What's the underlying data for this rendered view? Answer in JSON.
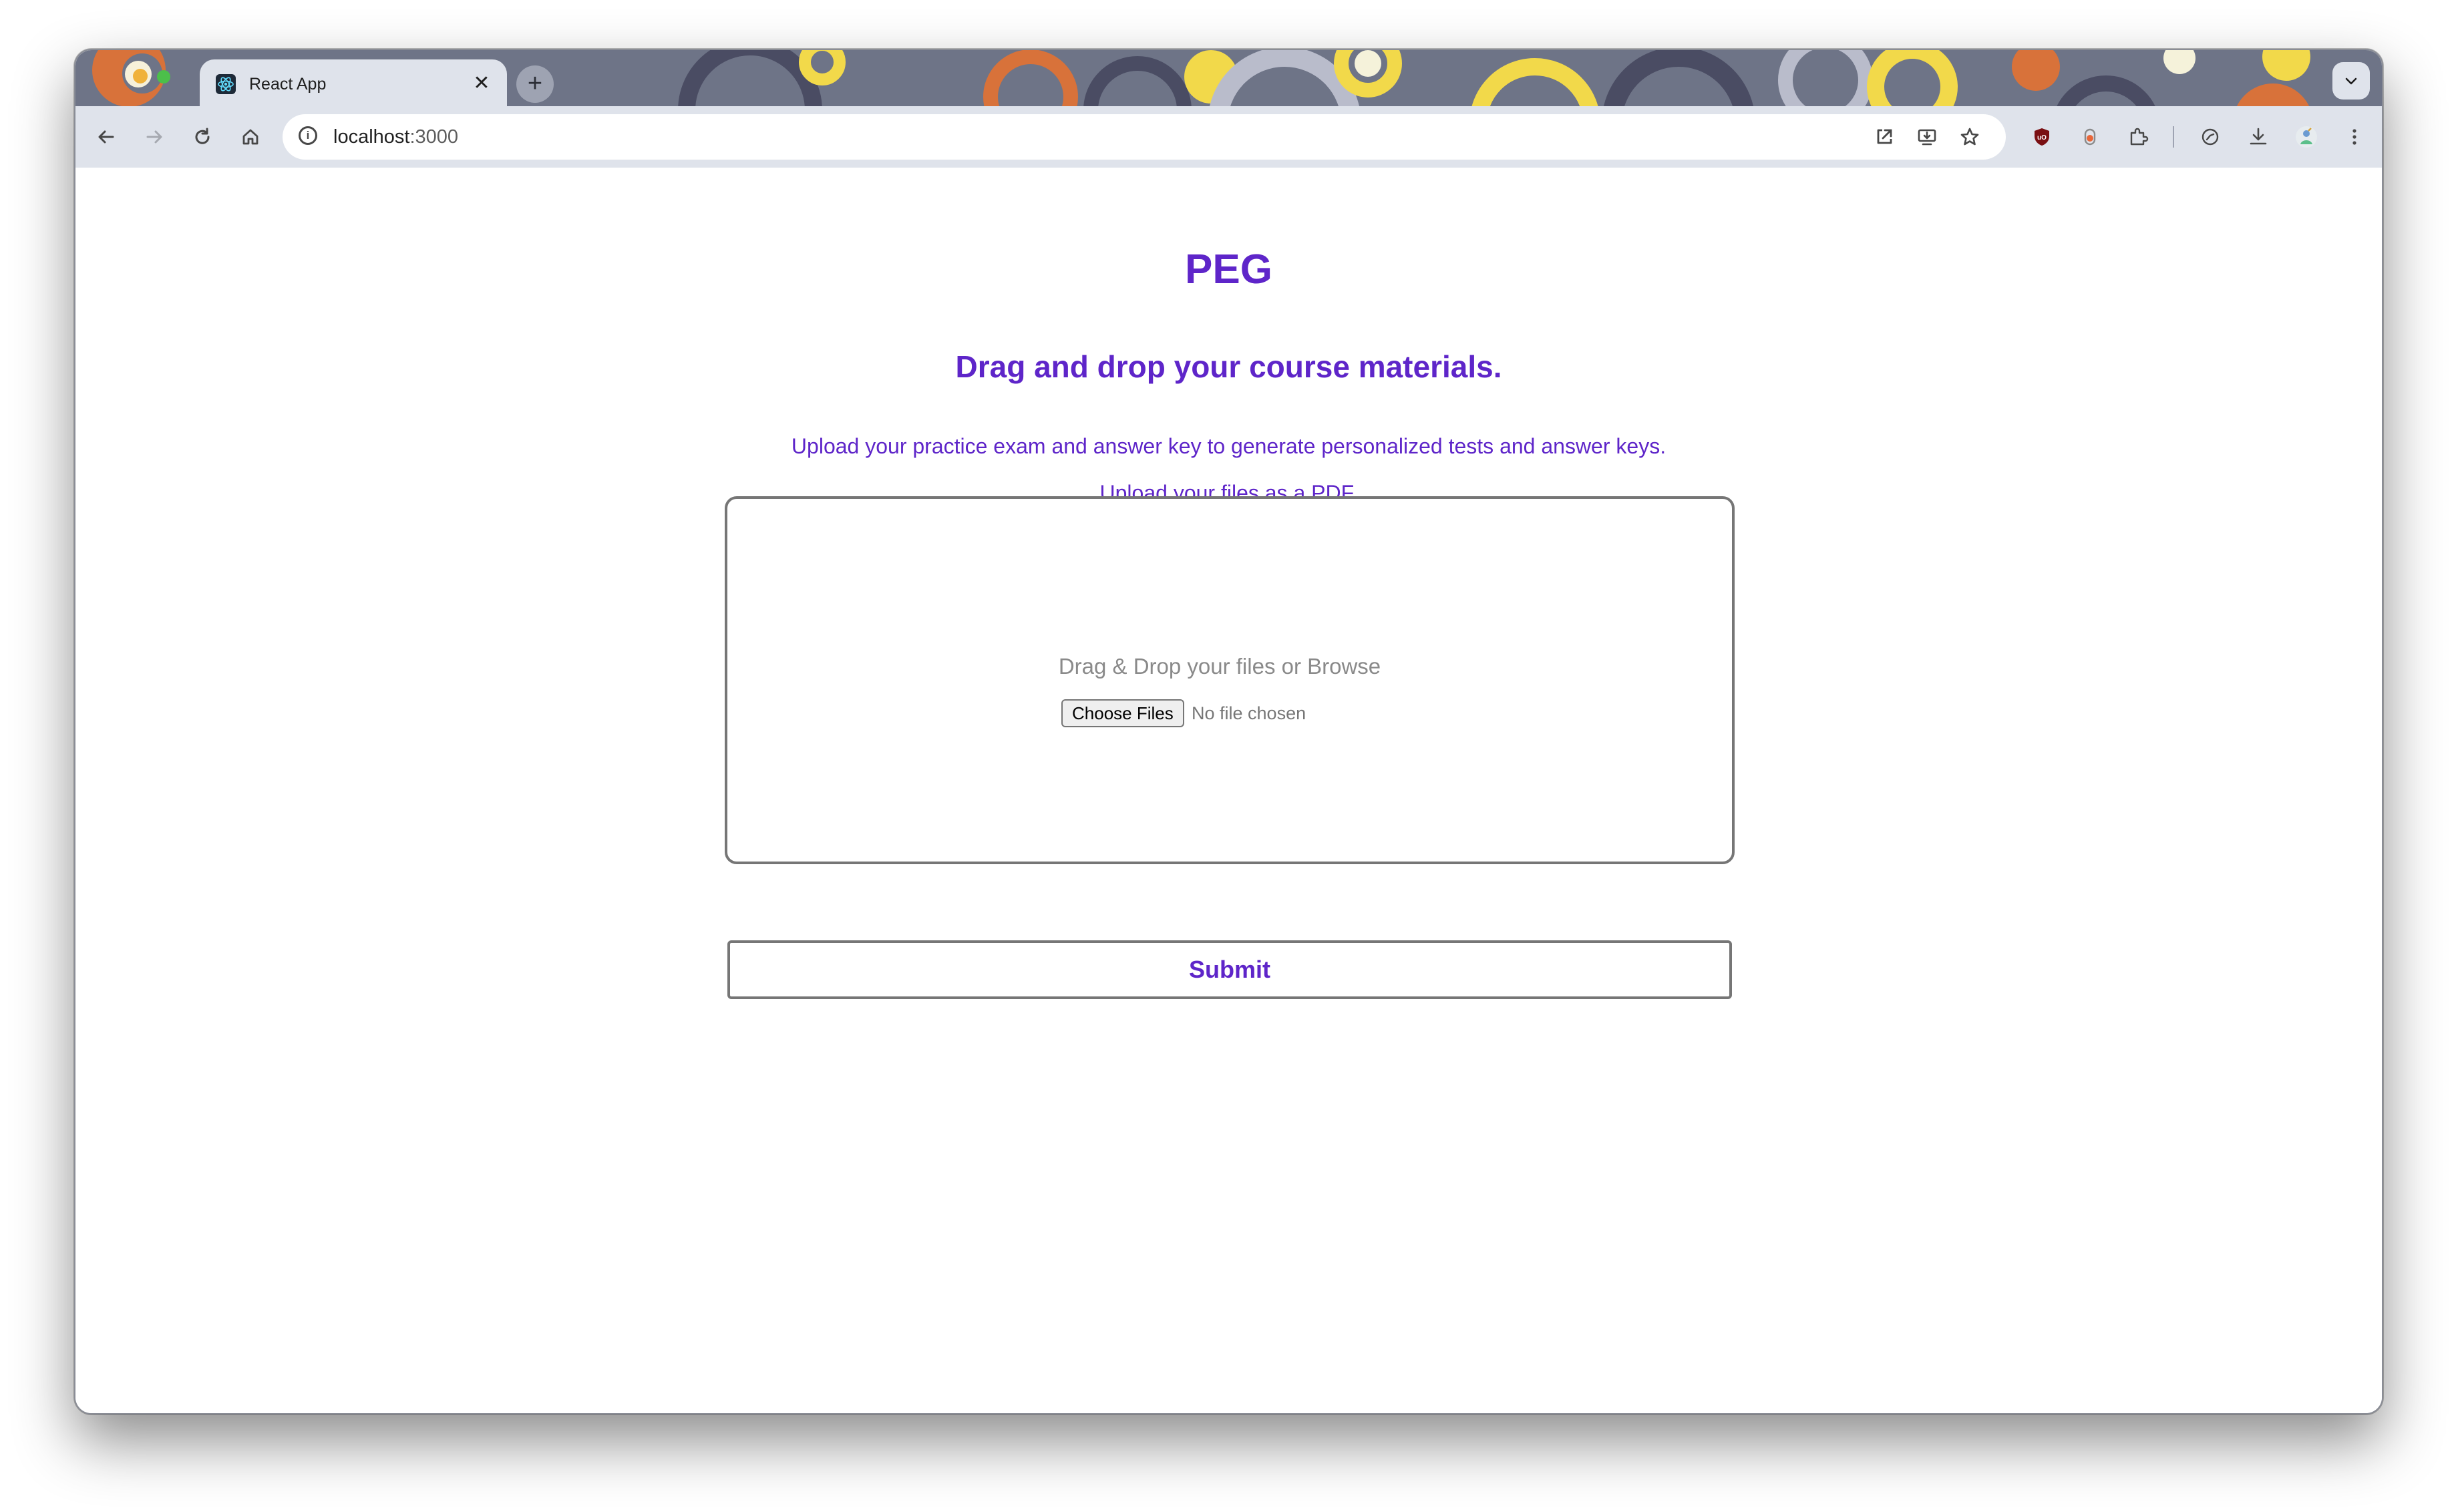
{
  "browser": {
    "tab_title": "React App",
    "tab_close_glyph": "✕",
    "new_tab_glyph": "+",
    "tab_search_glyph": "⌄",
    "url_host": "localhost",
    "url_port": ":3000",
    "icons": {
      "back": "back-arrow-icon",
      "forward": "forward-arrow-icon",
      "reload": "reload-icon",
      "home": "home-icon",
      "site_info": "info-icon",
      "open_in": "open-external-icon",
      "install": "install-app-icon",
      "bookmark": "star-icon",
      "ublock": "ublock-shield-icon",
      "extension_orange": "extension-icon",
      "extensions": "puzzle-icon",
      "performance": "gauge-icon",
      "downloads": "download-icon",
      "profile": "profile-avatar-icon",
      "menu": "kebab-menu-icon"
    }
  },
  "page": {
    "title": "PEG",
    "heading": "Drag and drop your course materials.",
    "description": "Upload your practice exam and answer key to generate personalized tests and answer keys.",
    "format_note": "Upload your files as a PDF.",
    "dropzone": {
      "prompt": "Drag & Drop your files or Browse",
      "choose_label": "Choose Files",
      "no_file_text": "No file chosen"
    },
    "submit_label": "Submit"
  },
  "colors": {
    "accent": "#5e25c9",
    "tabstrip_bg": "#6e7487",
    "toolbar_bg": "#dfe3eb",
    "border_gray": "#767676"
  }
}
